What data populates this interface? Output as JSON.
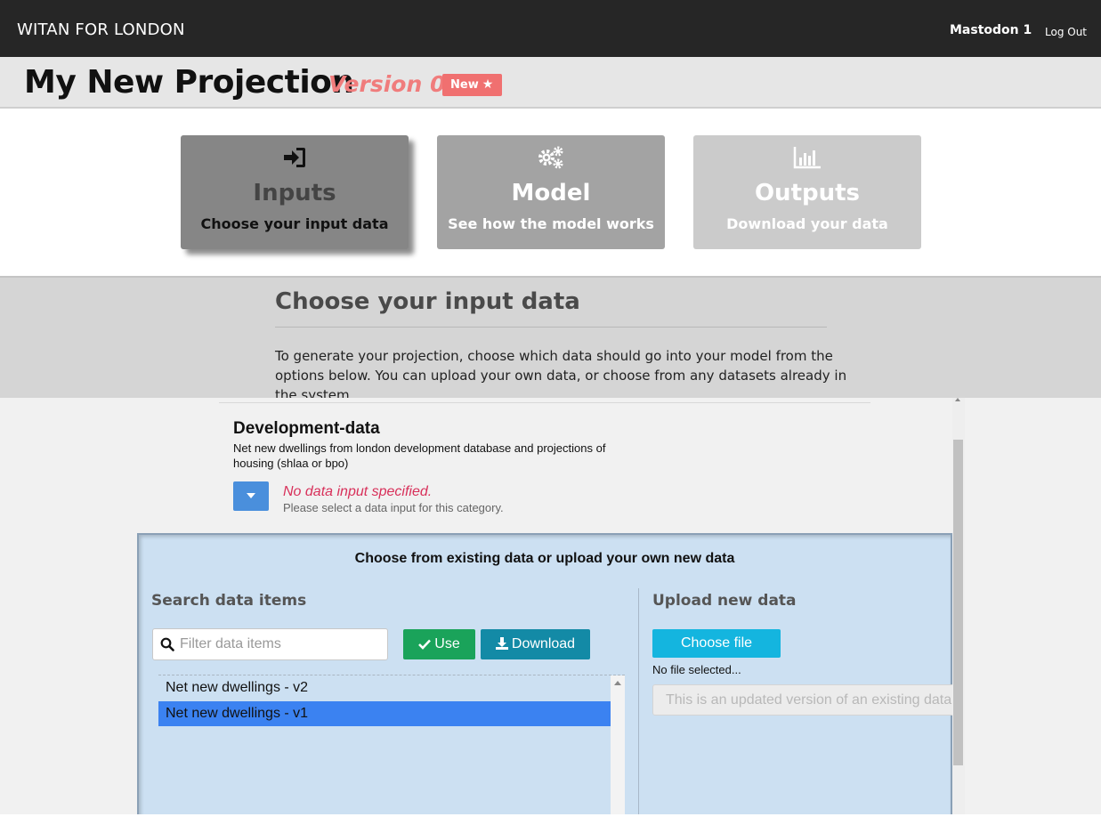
{
  "nav": {
    "brand": "WITAN FOR LONDON",
    "user": "Mastodon 1",
    "logout": "Log Out"
  },
  "header": {
    "title": "My New Projection",
    "version": "Version 0",
    "badge": "New"
  },
  "steps": [
    {
      "title": "Inputs",
      "subtitle": "Choose your input data",
      "icon": "sign-in-icon",
      "state": "active"
    },
    {
      "title": "Model",
      "subtitle": "See how the model works",
      "icon": "gears-icon",
      "state": "inactive"
    },
    {
      "title": "Outputs",
      "subtitle": "Download your data",
      "icon": "bar-chart-icon",
      "state": "disabled"
    }
  ],
  "intro": {
    "heading": "Choose your input data",
    "text": "To generate your projection, choose which data should go into your model from the options below. You can upload your own data, or choose from any datasets already in the system."
  },
  "category": {
    "title": "Development-data",
    "description": "Net new dwellings from london development database and projections of housing (shlaa or bpo)",
    "status": "No data input specified.",
    "hint": "Please select a data input for this category."
  },
  "chooser": {
    "title": "Choose from existing data or upload your own new data",
    "search": {
      "heading": "Search data items",
      "placeholder": "Filter data items",
      "use_label": "Use",
      "download_label": "Download",
      "items": [
        "Net new dwellings - v2",
        "Net new dwellings - v1"
      ],
      "selected_index": 1
    },
    "upload": {
      "heading": "Upload new data",
      "choose_label": "Choose file",
      "file_status": "No file selected...",
      "update_placeholder": "This is an updated version of an existing data"
    }
  },
  "colors": {
    "navbar": "#262626",
    "badge": "#f07070",
    "version": "#f07c7c",
    "status_error": "#d8305a",
    "use_button": "#1aa35a",
    "download_button": "#138aa6",
    "choose_button": "#14b5df",
    "selected_row": "#3b82f1",
    "panel": "#cce0f2"
  }
}
